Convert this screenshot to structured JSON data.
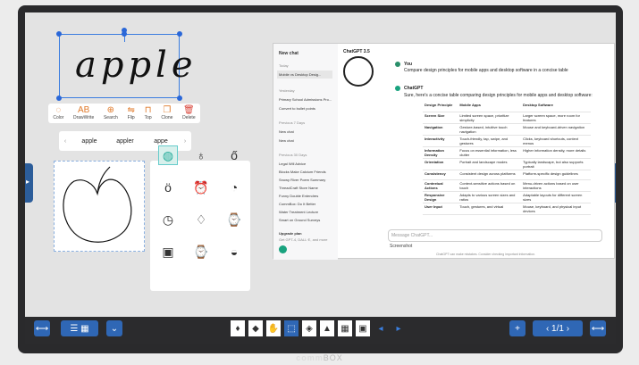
{
  "brand": {
    "main": "comm",
    "suffix": "BOX"
  },
  "handwriting": {
    "text": "apple"
  },
  "menu": [
    {
      "icon": "◌",
      "label": "Color"
    },
    {
      "icon": "AB",
      "label": "DrawWrite"
    },
    {
      "icon": "⊕",
      "label": "Search"
    },
    {
      "icon": "⇋",
      "label": "Flip"
    },
    {
      "icon": "⊓",
      "label": "Top"
    },
    {
      "icon": "❐",
      "label": "Clone"
    },
    {
      "icon": "🗑",
      "label": "Delete"
    }
  ],
  "suggestions": {
    "prev": "‹",
    "items": [
      "apple",
      "appler",
      "appe"
    ],
    "next": "›"
  },
  "chat": {
    "sidebar": {
      "new_chat": "New chat",
      "today": "Today",
      "active_item": "Mobile vs Desktop Desig...",
      "yesterday": "Yesterday",
      "y_items": [
        "Primary School Admissions Pro...",
        "Convert to bullet points"
      ],
      "prev7": "Previous 7 Days",
      "p7_items": [
        "New chat",
        "New chat"
      ],
      "prev30": "Previous 30 Days",
      "p30_items": [
        "Legal Will Advice",
        "Blocks Make Calcium Friends",
        "Snowy River Poem Summary",
        "ThreadCraft Store Name",
        "Funny Double Entendres",
        "CommBox: Do It Better",
        "Water Treatment Lecture",
        "Smart on Ground Surveys"
      ],
      "upgrade": "Upgrade plan",
      "upgrade_sub": "Get GPT-4, DALL·E, and more"
    },
    "model": "ChatGPT 3.5",
    "user_name": "You",
    "user_msg": "Compare design principles for mobile apps and desktop software in a concise table",
    "bot_name": "ChatGPT",
    "bot_msg": "Sure, here's a concise table comparing design principles for mobile apps and desktop software:",
    "table_headers": [
      "Design Principle",
      "Mobile Apps",
      "Desktop Software"
    ],
    "table_rows": [
      [
        "Screen Size",
        "Limited screen space, prioritize simplicity",
        "Larger screen space, more room for features"
      ],
      [
        "Navigation",
        "Gesture-based, intuitive touch navigation",
        "Mouse and keyboard-driven navigation"
      ],
      [
        "Interactivity",
        "Touch-friendly, tap, swipe, and gestures",
        "Clicks, keyboard shortcuts, context menus"
      ],
      [
        "Information Density",
        "Focus on essential information, less clutter",
        "Higher information density, more details"
      ],
      [
        "Orientation",
        "Portrait and landscape modes",
        "Typically landscape, but also supports portrait"
      ],
      [
        "Consistency",
        "Consistent design across platforms",
        "Platform-specific design guidelines"
      ],
      [
        "Contextual Actions",
        "Context-sensitive actions based on touch",
        "Menu-driven actions based on user interactions"
      ],
      [
        "Responsive Design",
        "Adapts to various screen sizes and ratios",
        "Adaptable layouts for different screen sizes"
      ],
      [
        "User Input",
        "Touch, gestures, and virtual",
        "Mouse, keyboard, and physical input devices"
      ]
    ],
    "input_placeholder": "Message ChatGPT...",
    "screenshot_label": "Screenshot",
    "disclaimer": "ChatGPT can make mistakes. Consider checking important information."
  },
  "pagination": "1/1"
}
